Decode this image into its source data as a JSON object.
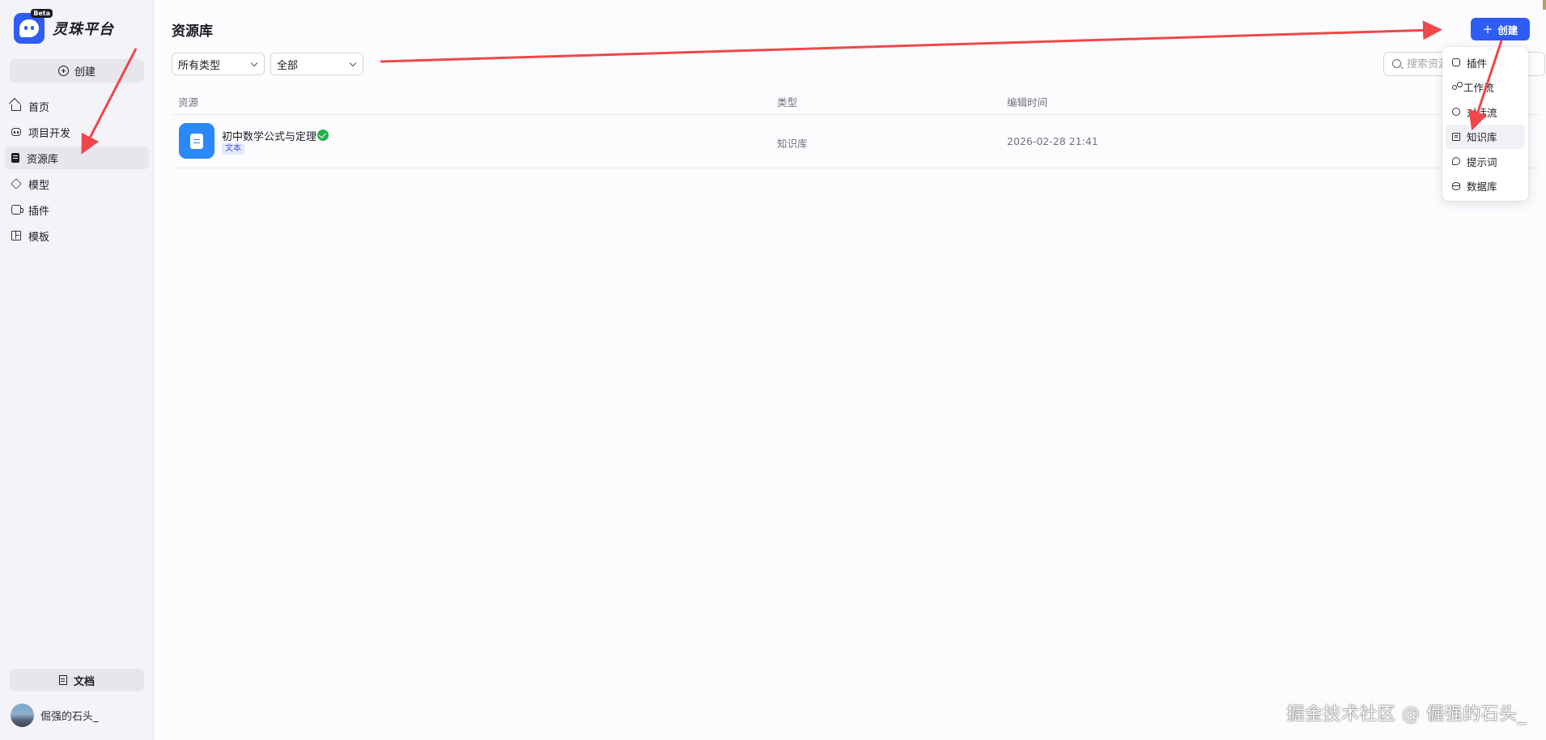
{
  "brand": {
    "name": "灵珠平台",
    "badge": "Beta"
  },
  "sidebar": {
    "create_label": "创建",
    "items": [
      {
        "label": "首页",
        "icon": "home-icon"
      },
      {
        "label": "项目开发",
        "icon": "project-icon"
      },
      {
        "label": "资源库",
        "icon": "library-icon",
        "active": true
      },
      {
        "label": "模型",
        "icon": "cube-icon"
      },
      {
        "label": "插件",
        "icon": "plugin-icon"
      },
      {
        "label": "模板",
        "icon": "template-icon"
      }
    ],
    "docs_label": "文档",
    "user_name": "倔强的石头_"
  },
  "main": {
    "title": "资源库",
    "filters": {
      "type": "所有类型",
      "scope": "全部"
    },
    "search_placeholder": "搜索资源",
    "table": {
      "headers": [
        "资源",
        "类型",
        "编辑时间"
      ],
      "rows": [
        {
          "name": "初中数学公式与定理",
          "tag": "文本",
          "type": "知识库",
          "edited": "2026-02-28 21:41",
          "status": "published"
        }
      ]
    }
  },
  "create_button": {
    "label": "创建"
  },
  "create_menu": [
    {
      "label": "插件",
      "icon": "plugin-icon"
    },
    {
      "label": "工作流",
      "icon": "workflow-icon"
    },
    {
      "label": "对话流",
      "icon": "chatflow-icon"
    },
    {
      "label": "知识库",
      "icon": "knowledge-icon",
      "hovered": true
    },
    {
      "label": "提示词",
      "icon": "prompt-icon"
    },
    {
      "label": "数据库",
      "icon": "database-icon"
    }
  ],
  "watermark": "掘金技术社区 @ 倔强的石头_",
  "colors": {
    "accent": "#2f5cf5",
    "arrow": "#f0474a",
    "success": "#20b04b",
    "file_icon": "#2a88f7"
  }
}
